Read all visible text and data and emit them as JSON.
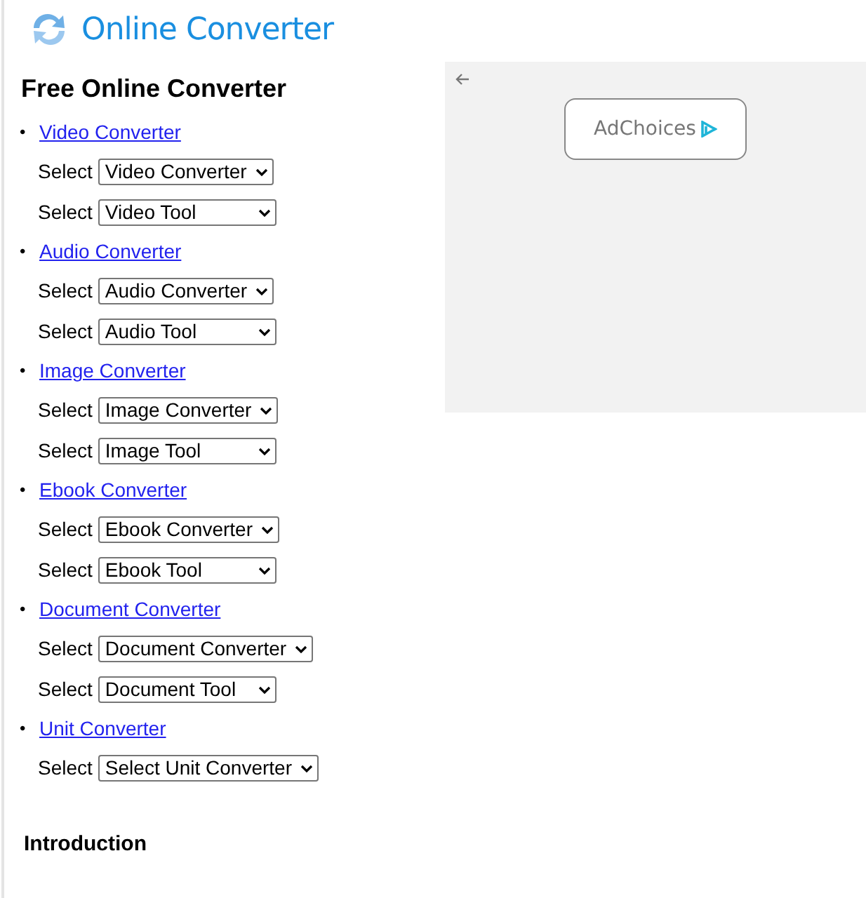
{
  "header": {
    "logo_text": "Online Converter"
  },
  "heading": "Free Online Converter",
  "categories": [
    {
      "bullet": "•",
      "link": "Video Converter",
      "selects": [
        {
          "label": "Select",
          "value": "Video Converter",
          "kind": "converter"
        },
        {
          "label": "Select",
          "value": "Video Tool",
          "kind": "tool"
        }
      ]
    },
    {
      "bullet": "•",
      "link": "Audio Converter",
      "selects": [
        {
          "label": "Select",
          "value": "Audio Converter",
          "kind": "converter"
        },
        {
          "label": "Select",
          "value": "Audio Tool",
          "kind": "tool"
        }
      ]
    },
    {
      "bullet": "•",
      "link": "Image Converter",
      "selects": [
        {
          "label": "Select",
          "value": "Image Converter",
          "kind": "converter"
        },
        {
          "label": "Select",
          "value": "Image Tool",
          "kind": "tool"
        }
      ]
    },
    {
      "bullet": "•",
      "link": "Ebook Converter",
      "selects": [
        {
          "label": "Select",
          "value": "Ebook Converter",
          "kind": "converter"
        },
        {
          "label": "Select",
          "value": "Ebook Tool",
          "kind": "tool"
        }
      ]
    },
    {
      "bullet": "•",
      "link": "Document Converter",
      "selects": [
        {
          "label": "Select",
          "value": "Document Converter",
          "kind": "converter"
        },
        {
          "label": "Select",
          "value": "Document Tool",
          "kind": "tool"
        }
      ]
    },
    {
      "bullet": "•",
      "link": "Unit Converter",
      "selects": [
        {
          "label": "Select",
          "value": "Select Unit Converter",
          "kind": "tool"
        }
      ]
    }
  ],
  "section_heading": "Introduction",
  "ad": {
    "button": "AdChoices"
  }
}
